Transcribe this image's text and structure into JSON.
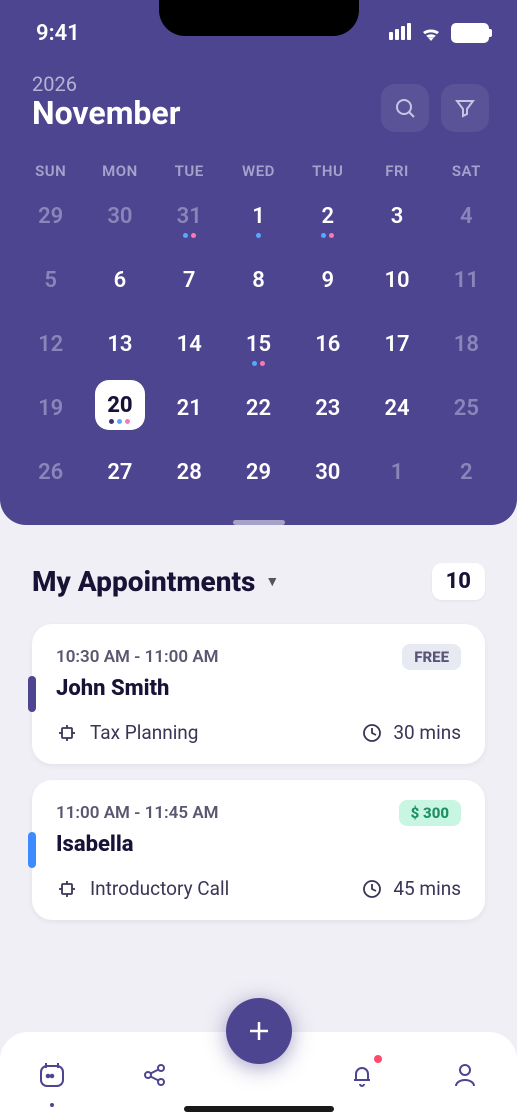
{
  "status": {
    "time": "9:41"
  },
  "header": {
    "year": "2026",
    "month": "November"
  },
  "weekdays": [
    "SUN",
    "MON",
    "TUE",
    "WED",
    "THU",
    "FRI",
    "SAT"
  ],
  "calendar": {
    "selected_day": 20,
    "rows": [
      [
        {
          "n": 29,
          "dim": true
        },
        {
          "n": 30,
          "dim": true
        },
        {
          "n": 31,
          "dim": true,
          "dots": [
            "b",
            "p"
          ]
        },
        {
          "n": 1,
          "dots": [
            "b"
          ]
        },
        {
          "n": 2,
          "dots": [
            "b",
            "p"
          ]
        },
        {
          "n": 3
        },
        {
          "n": 4,
          "dim": true
        }
      ],
      [
        {
          "n": 5,
          "dim": true
        },
        {
          "n": 6
        },
        {
          "n": 7
        },
        {
          "n": 8
        },
        {
          "n": 9
        },
        {
          "n": 10
        },
        {
          "n": 11,
          "dim": true
        }
      ],
      [
        {
          "n": 12,
          "dim": true
        },
        {
          "n": 13
        },
        {
          "n": 14
        },
        {
          "n": 15,
          "dots": [
            "b",
            "p"
          ]
        },
        {
          "n": 16
        },
        {
          "n": 17
        },
        {
          "n": 18,
          "dim": true
        }
      ],
      [
        {
          "n": 19,
          "dim": true
        },
        {
          "n": 20,
          "today": true,
          "dots": [
            "d",
            "b",
            "p"
          ]
        },
        {
          "n": 21
        },
        {
          "n": 22
        },
        {
          "n": 23
        },
        {
          "n": 24
        },
        {
          "n": 25,
          "dim": true
        }
      ],
      [
        {
          "n": 26,
          "dim": true
        },
        {
          "n": 27
        },
        {
          "n": 28
        },
        {
          "n": 29
        },
        {
          "n": 30
        },
        {
          "n": 1,
          "dim": true
        },
        {
          "n": 2,
          "dim": true
        }
      ]
    ]
  },
  "appointments": {
    "title": "My Appointments",
    "count": "10",
    "items": [
      {
        "time": "10:30 AM - 11:00 AM",
        "badge": "FREE",
        "badge_type": "free",
        "name": "John Smith",
        "tag": "Tax Planning",
        "duration": "30 mins",
        "accent": "purple"
      },
      {
        "time": "11:00 AM - 11:45 AM",
        "badge": "$ 300",
        "badge_type": "price",
        "name": "Isabella",
        "tag": "Introductory Call",
        "duration": "45 mins",
        "accent": "blue"
      }
    ]
  },
  "nav": {
    "items": [
      "calendar",
      "share",
      "add",
      "notifications",
      "profile"
    ],
    "active": "calendar"
  }
}
